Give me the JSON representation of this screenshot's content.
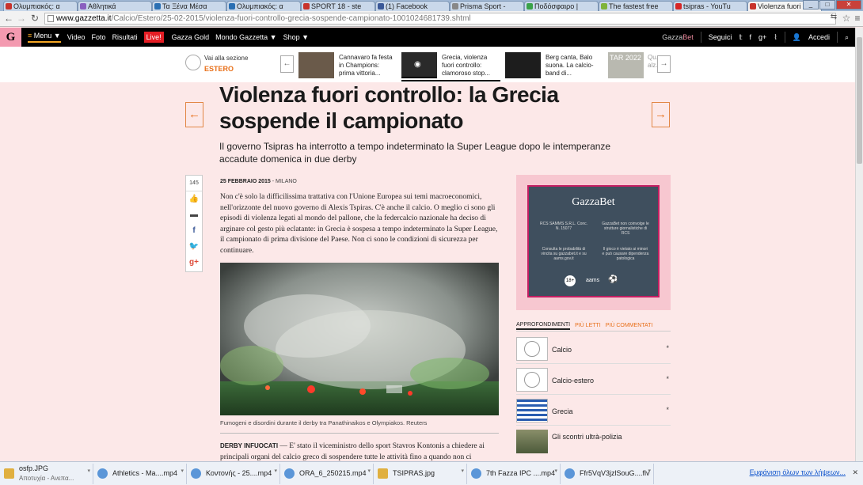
{
  "browser": {
    "tabs": [
      {
        "label": "Ολυμπιακός: α",
        "color": "#c8332c"
      },
      {
        "label": "Αθλητικά",
        "color": "#8a5fbf"
      },
      {
        "label": "Τα Ξένα Μέσα",
        "color": "#2a6fb3"
      },
      {
        "label": "Ολυμπιακός: α",
        "color": "#2a6fb3"
      },
      {
        "label": "SPORT 18 - ste",
        "color": "#c8332c"
      },
      {
        "label": "(1) Facebook",
        "color": "#3b5998"
      },
      {
        "label": "Prisma Sport -",
        "color": "#888888"
      },
      {
        "label": "Ποδόσφαιρο |",
        "color": "#3aa24a"
      },
      {
        "label": "The fastest free",
        "color": "#7fb33a"
      },
      {
        "label": "tsipras - YouTu",
        "color": "#d62626"
      },
      {
        "label": "Violenza fuori",
        "color": "#c8332c"
      }
    ],
    "url_host": "www.gazzetta.it",
    "url_path": "/Calcio/Estero/25-02-2015/violenza-fuori-controllo-grecia-sospende-campionato-1001024681739.shtml"
  },
  "sitenav": {
    "logo": "G",
    "items": [
      "Menu ▼",
      "Video",
      "Foto",
      "Risultati"
    ],
    "live": "Live!",
    "items2": [
      "Gazza Gold",
      "Mondo Gazzetta ▼",
      "Shop ▼"
    ],
    "gazzabet_a": "Gazza",
    "gazzabet_b": "Bet",
    "seguici": "Seguici",
    "accedi": "Accedi"
  },
  "subheader": {
    "section_label": "Vai alla sezione",
    "section_name": "ESTERO",
    "carousel": [
      {
        "text": "Cannavaro fa festa in Champions: prima vittoria..."
      },
      {
        "text": "Grecia, violenza fuori controllo: clamoroso stop..."
      },
      {
        "text": "Berg canta, Balo suona. La calcio-band di..."
      },
      {
        "text": "Qu... alz..."
      }
    ],
    "qatar_label": "TAR 2022"
  },
  "article": {
    "headline": "Violenza fuori controllo: la Grecia sospende il campionato",
    "subhead": "Il governo Tsipras ha interrotto a tempo indeterminato la Super League dopo le intemperanze accadute domenica in due derby",
    "share_count": "145",
    "date": "25 FEBBRAIO 2015",
    "place": " - MILANO",
    "p1": "Non c'è solo la difficilissima trattativa con l'Unione Europea sui temi macroeconomici, nell'orizzonte del nuovo governo di Alexis Tspiras. C'è anche il calcio. O meglio ci sono gli episodi di violenza legati al mondo del pallone, che la federcalcio nazionale ha deciso di arginare col gesto più eclatante: in Grecia è sospesa a tempo indeterminato la Super League, il campionato di prima divisione del Paese. Non ci sono le condizioni di sicurezza per continuare.",
    "caption": "Fumogeni e disordini durante il derby tra Panathinaikos e Olympiakos. Reuters",
    "p2_lead": "DERBY INFUOCATI",
    "p2": " — E' stato il viceministro dello sport Stavros Kontonis a chiedere ai principali organi del calcio greco di sospendere tutte le attività fino a quando non ci"
  },
  "ad": {
    "title": "GazzaBet",
    "col1a": "RCS SAMMS S.R.L. Conc. N. 15077",
    "col1b": "Consulta le probabilità di vincita su gazzabet.it e su aams.gov.it",
    "col2a": "GazzaBet non coinvolge le strutture giornalistiche di RCS",
    "col2b": "Il gioco è vietato ai minori e può causare dipendenza patologica",
    "badge": "18+",
    "logo2": "aams"
  },
  "sidebar": {
    "tabs": [
      "APPROFONDIMENTI",
      "PIÙ LETTI",
      "PIÙ COMMENTATI"
    ],
    "related": [
      {
        "label": "Calcio",
        "star": "*"
      },
      {
        "label": "Calcio-estero",
        "star": "*"
      },
      {
        "label": "Grecia",
        "star": "*"
      },
      {
        "label": "Gli scontri ultrà-polizia",
        "star": ""
      }
    ]
  },
  "downloads": {
    "items": [
      {
        "name": "osfp.JPG",
        "status": "Αποτυχία - Ανεπα..."
      },
      {
        "name": "Athletics - Ma....mp4",
        "status": ""
      },
      {
        "name": "Κοντονής - 25....mp4",
        "status": ""
      },
      {
        "name": "ORA_6_250215.mp4",
        "status": ""
      },
      {
        "name": "TSIPRAS.jpg",
        "status": ""
      },
      {
        "name": "7th Fazza IPC ....mp4",
        "status": ""
      },
      {
        "name": "Ffr5VqV3jzlSouG....flv",
        "status": ""
      }
    ],
    "show_all": "Εμφάνιση όλων των λήψεων..."
  }
}
